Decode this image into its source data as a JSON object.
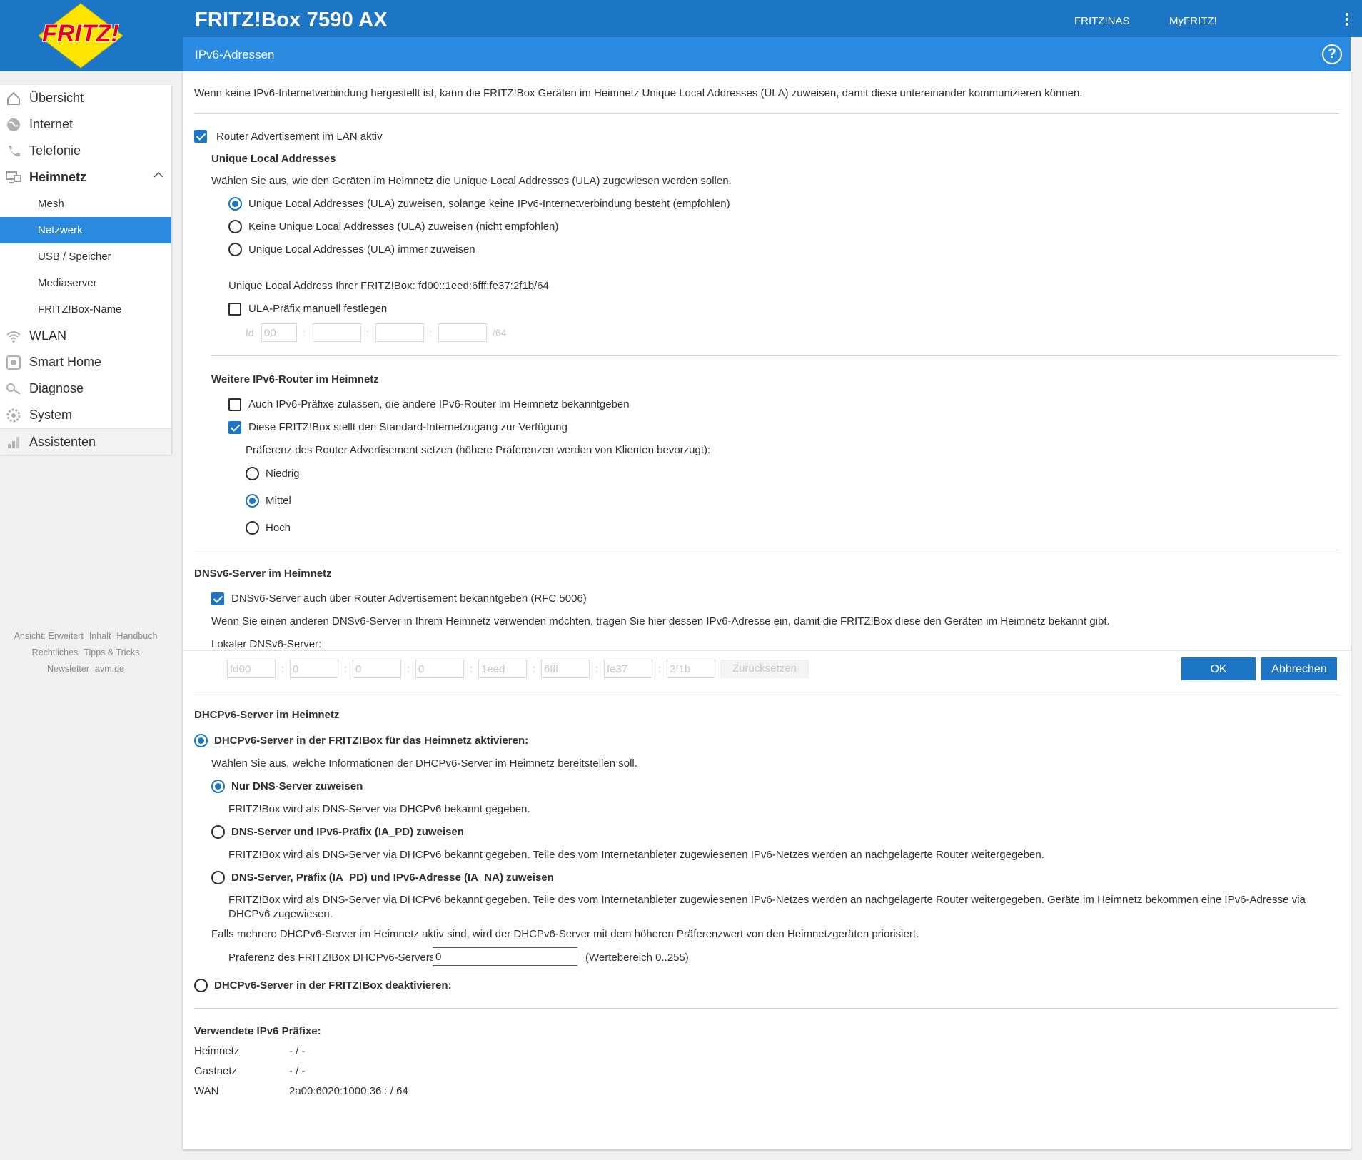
{
  "header": {
    "logo_text": "FRITZ!",
    "title": "FRITZ!Box 7590 AX",
    "links": [
      "FRITZ!NAS",
      "MyFRITZ!"
    ],
    "page_title": "IPv6-Adressen"
  },
  "sidebar": {
    "items": [
      {
        "label": "Übersicht",
        "icon": "home-icon"
      },
      {
        "label": "Internet",
        "icon": "globe-icon"
      },
      {
        "label": "Telefonie",
        "icon": "phone-icon"
      },
      {
        "label": "Heimnetz",
        "icon": "network-icon",
        "expanded": true
      },
      {
        "label": "WLAN",
        "icon": "wifi-icon"
      },
      {
        "label": "Smart Home",
        "icon": "smarthome-icon"
      },
      {
        "label": "Diagnose",
        "icon": "diagnose-icon"
      },
      {
        "label": "System",
        "icon": "system-icon"
      },
      {
        "label": "Assistenten",
        "icon": "wizard-icon"
      }
    ],
    "subitems": [
      "Mesh",
      "Netzwerk",
      "USB / Speicher",
      "Mediaserver",
      "FRITZ!Box-Name"
    ],
    "active_subitem": "Netzwerk",
    "footer": [
      "Ansicht: Erweitert",
      "Inhalt",
      "Handbuch",
      "Rechtliches",
      "Tipps & Tricks",
      "Newsletter",
      "avm.de"
    ]
  },
  "main": {
    "intro": "Wenn keine IPv6-Internetverbindung hergestellt ist, kann die FRITZ!Box Geräten im Heimnetz Unique Local Addresses (ULA) zuweisen, damit diese untereinander kommunizieren können.",
    "router_adv_label": "Router Advertisement im LAN aktiv",
    "router_adv_checked": true,
    "ula": {
      "heading": "Unique Local Addresses",
      "desc": "Wählen Sie aus, wie den Geräten im Heimnetz die Unique Local Addresses (ULA) zugewiesen werden sollen.",
      "options": [
        "Unique Local Addresses (ULA) zuweisen, solange keine IPv6-Internetverbindung besteht (empfohlen)",
        "Keine Unique Local Addresses (ULA) zuweisen (nicht empfohlen)",
        "Unique Local Addresses (ULA) immer zuweisen"
      ],
      "selected": 0,
      "address_text": "Unique Local Address Ihrer FRITZ!Box: fd00::1eed:6fff:fe37:2f1b/64",
      "manual_label": "ULA-Präfix manuell festlegen",
      "manual_checked": false,
      "prefix_lead": "fd",
      "prefix_values": [
        "00",
        "",
        "",
        ""
      ],
      "prefix_suffix": "/64"
    },
    "routers": {
      "heading": "Weitere IPv6-Router im Heimnetz",
      "allow_label": "Auch IPv6-Präfixe zulassen, die andere IPv6-Router im Heimnetz bekanntgeben",
      "allow_checked": false,
      "default_label": "Diese FRITZ!Box stellt den Standard-Internetzugang zur Verfügung",
      "default_checked": true,
      "pref_text": "Präferenz des Router Advertisement setzen (höhere Präferenzen werden von Klienten bevorzugt):",
      "pref_options": [
        "Niedrig",
        "Mittel",
        "Hoch"
      ],
      "pref_selected": 1
    },
    "dns": {
      "heading": "DNSv6-Server im Heimnetz",
      "announce_label": "DNSv6-Server auch über Router Advertisement bekanntgeben (RFC 5006)",
      "announce_checked": true,
      "desc": "Wenn Sie einen anderen DNSv6-Server in Ihrem Heimnetz verwenden möchten, tragen Sie hier dessen IPv6-Adresse ein, damit die FRITZ!Box diese den Geräten im Heimnetz bekannt gibt.",
      "local_label": "Lokaler DNSv6-Server:",
      "fields": [
        "fd00",
        "0",
        "0",
        "0",
        "1eed",
        "6fff",
        "fe37",
        "2f1b"
      ],
      "reset_label": "Zurücksetzen"
    },
    "dhcp": {
      "heading": "DHCPv6-Server im Heimnetz",
      "enable_label": "DHCPv6-Server in der FRITZ!Box für das Heimnetz aktivieren:",
      "enable_selected": true,
      "choose_text": "Wählen Sie aus, welche Informationen der DHCPv6-Server im Heimnetz bereitstellen soll.",
      "opt1_label": "Nur DNS-Server zuweisen",
      "opt1_desc": "FRITZ!Box wird als DNS-Server via DHCPv6 bekannt gegeben.",
      "opt2_label": "DNS-Server und IPv6-Präfix (IA_PD) zuweisen",
      "opt2_desc": "FRITZ!Box wird als DNS-Server via DHCPv6 bekannt gegeben. Teile des vom Internetanbieter zugewiesenen IPv6-Netzes werden an nachgelagerte Router weitergegeben.",
      "opt3_label": "DNS-Server, Präfix (IA_PD) und IPv6-Adresse (IA_NA) zuweisen",
      "opt3_desc": "FRITZ!Box wird als DNS-Server via DHCPv6 bekannt gegeben. Teile des vom Internetanbieter zugewiesenen IPv6-Netzes werden an nachgelagerte Router weitergegeben. Geräte im Heimnetz bekommen eine IPv6-Adresse via DHCPv6 zugewiesen.",
      "selected": 0,
      "multi_text": "Falls mehrere DHCPv6-Server im Heimnetz aktiv sind, wird der DHCPv6-Server mit dem höheren Präferenzwert von den Heimnetzgeräten priorisiert.",
      "pref_label": "Präferenz des FRITZ!Box DHCPv6-Servers:",
      "pref_value": "0",
      "pref_range": "(Wertebereich 0..255)",
      "disable_label": "DHCPv6-Server in der FRITZ!Box deaktivieren:"
    },
    "prefixes": {
      "heading": "Verwendete IPv6 Präfixe:",
      "rows": [
        {
          "name": "Heimnetz",
          "value": "- / -"
        },
        {
          "name": "Gastnetz",
          "value": "- / -"
        },
        {
          "name": "WAN",
          "value": "2a00:6020:1000:36:: / 64"
        }
      ]
    },
    "buttons": {
      "ok": "OK",
      "cancel": "Abbrechen"
    }
  },
  "colors": {
    "accent": "#1c75c5",
    "subbar": "#2a8ae0"
  }
}
